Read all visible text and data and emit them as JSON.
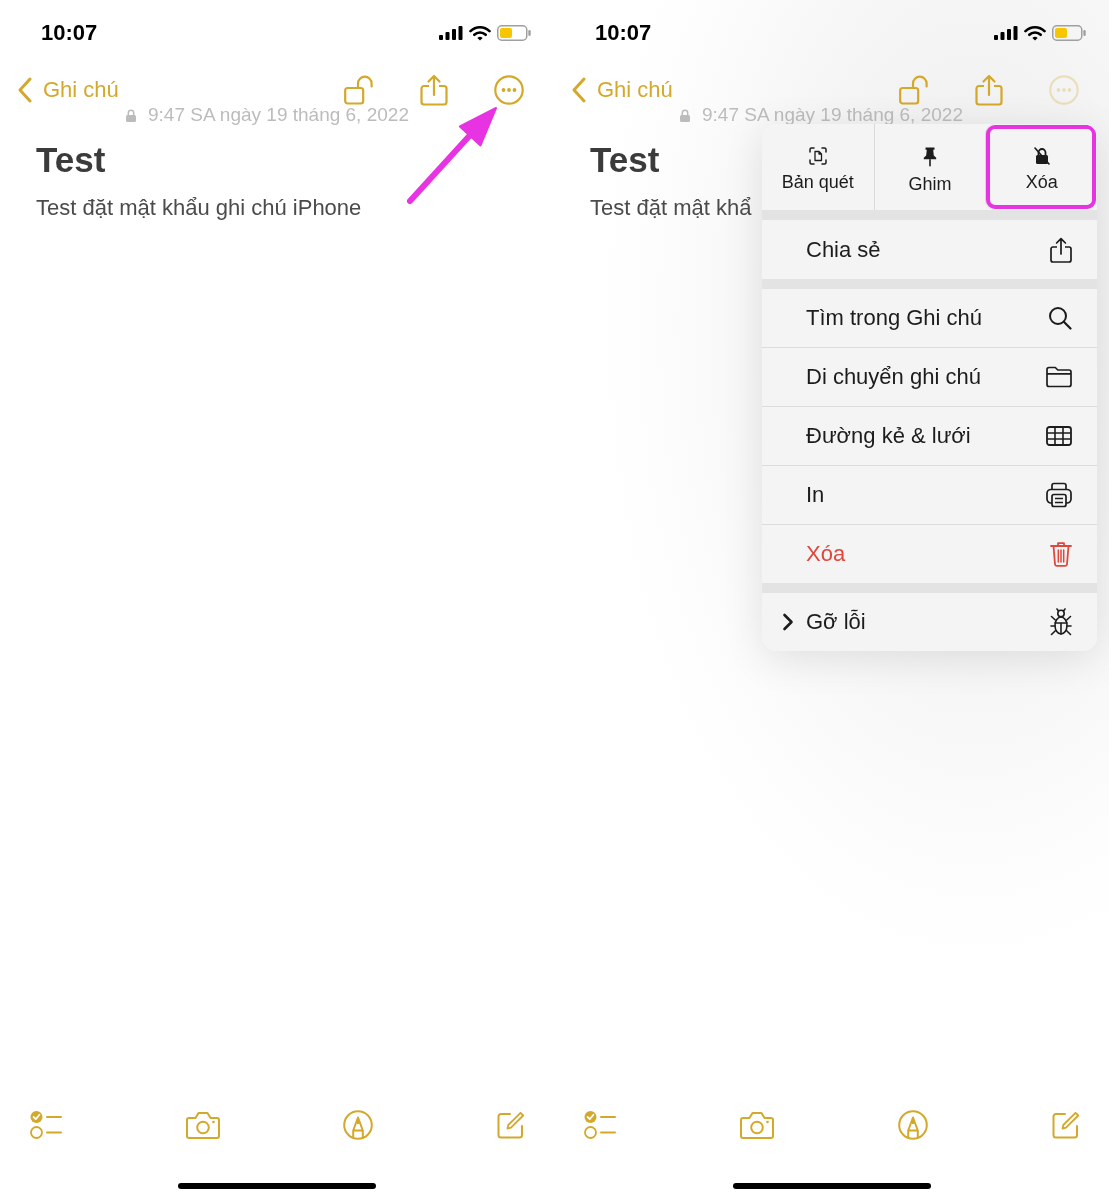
{
  "screens": [
    {
      "status_bar": {
        "time": "10:07"
      },
      "nav": {
        "back_label": "Ghi chú"
      },
      "date": "9:47 SA ngày 19 tháng 6, 2022",
      "note": {
        "title": "Test",
        "body": "Test đặt mật khẩu ghi chú iPhone"
      },
      "pointer_arrow": true,
      "menu_open": false
    },
    {
      "status_bar": {
        "time": "10:07"
      },
      "nav": {
        "back_label": "Ghi chú"
      },
      "date": "9:47 SA ngày 19 tháng 6, 2022",
      "note": {
        "title": "Test",
        "body": "Test đặt mật khẩ"
      },
      "menu_open": true,
      "menu": {
        "quick_actions": [
          {
            "kind": "scan",
            "label": "Bản quét",
            "highlighted": false
          },
          {
            "kind": "pin",
            "label": "Ghim",
            "highlighted": false
          },
          {
            "kind": "unlock",
            "label": "Xóa",
            "highlighted": true
          }
        ],
        "groups": [
          [
            {
              "kind": "share",
              "label": "Chia sẻ",
              "destructive": false,
              "submenu": false
            }
          ],
          [
            {
              "kind": "search",
              "label": "Tìm trong Ghi chú",
              "destructive": false,
              "submenu": false
            },
            {
              "kind": "folder",
              "label": "Di chuyển ghi chú",
              "destructive": false,
              "submenu": false
            },
            {
              "kind": "grid",
              "label": "Đường kẻ & lưới",
              "destructive": false,
              "submenu": false
            },
            {
              "kind": "print",
              "label": "In",
              "destructive": false,
              "submenu": false
            },
            {
              "kind": "delete",
              "label": "Xóa",
              "destructive": true,
              "submenu": false
            }
          ],
          [
            {
              "kind": "debug",
              "label": "Gỡ lỗi",
              "destructive": false,
              "submenu": true
            }
          ]
        ]
      }
    }
  ]
}
